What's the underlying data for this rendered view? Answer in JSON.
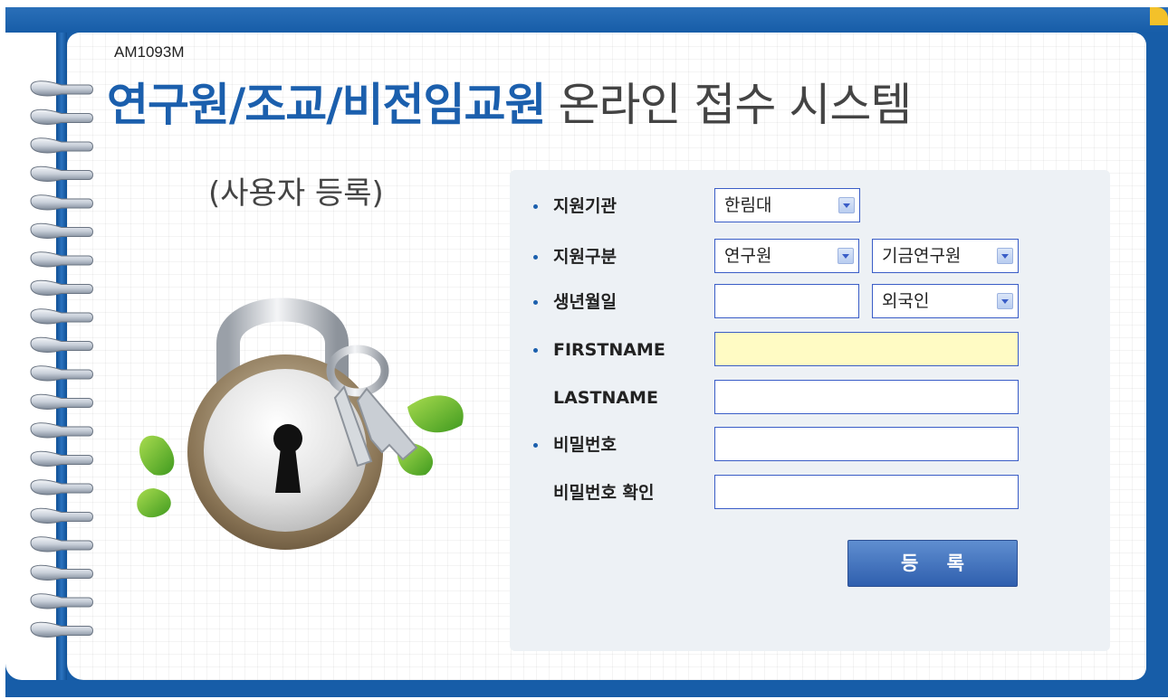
{
  "system": {
    "code": "AM1093M",
    "title_strong": "연구원/조교/비전임교원",
    "title_light": "온라인 접수 시스템",
    "subtitle": "(사용자 등록)"
  },
  "form": {
    "institution": {
      "label": "지원기관",
      "value": "한림대"
    },
    "category": {
      "label": "지원구분",
      "type_value": "연구원",
      "subtype_value": "기금연구원"
    },
    "birthdate": {
      "label": "생년월일",
      "value": "",
      "nationality_value": "외국인"
    },
    "firstname": {
      "label": "FIRSTNAME",
      "value": ""
    },
    "lastname": {
      "label": "LASTNAME",
      "value": ""
    },
    "password": {
      "label": "비밀번호",
      "value": ""
    },
    "password_confirm": {
      "label": "비밀번호 확인",
      "value": ""
    },
    "submit_label": "등 록"
  },
  "colors": {
    "frame_blue": "#175da8",
    "title_blue": "#1b5fad",
    "panel_bg": "#edf1f5",
    "highlight_input": "#fffbc4",
    "accent_gold": "#f3c12a"
  },
  "icons": [
    "spiral-binding-icon",
    "padlock-icon",
    "key-icon",
    "leaf-icon",
    "dropdown-arrow-icon"
  ]
}
